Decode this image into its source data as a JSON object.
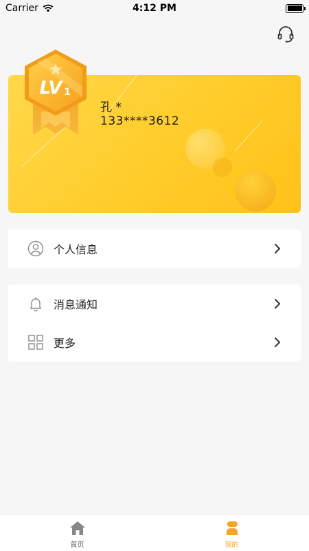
{
  "status_bar": {
    "carrier": "Carrier",
    "time": "4:12 PM"
  },
  "badge": {
    "level_text": "LV",
    "level_number": "1"
  },
  "profile": {
    "name": "孔 *",
    "phone": "133****3612"
  },
  "menu_groups": [
    {
      "items": [
        {
          "label": "个人信息",
          "icon": "user-icon"
        }
      ]
    },
    {
      "items": [
        {
          "label": "消息通知",
          "icon": "bell-icon"
        },
        {
          "label": "更多",
          "icon": "grid-icon"
        }
      ]
    }
  ],
  "tab_bar": {
    "tabs": [
      {
        "label": "首页",
        "icon": "home-icon",
        "active": false
      },
      {
        "label": "我的",
        "icon": "profile-icon",
        "active": true
      }
    ]
  },
  "colors": {
    "accent": "#f5a623",
    "card_start": "#ffd84a",
    "card_end": "#ffc21a",
    "inactive_tab": "#888888",
    "icon_gray": "#8a8a8a"
  }
}
